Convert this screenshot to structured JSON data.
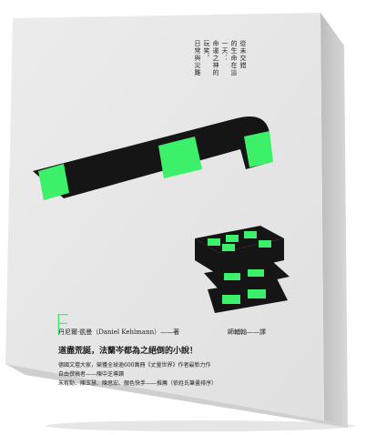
{
  "colors": {
    "cover": "#e9e9e9",
    "spine": "#c9c9c9",
    "ink": "#1a1a1a",
    "accent": "#3cf06a"
  },
  "cover": {
    "blurb_columns": [
      "從未交錯",
      "的生命在這",
      "一天：",
      "命運之神的",
      "玩笑，",
      "日常與災難"
    ],
    "letter_mark": "F",
    "author": "丹尼爾·凱曼（Daniel Kehlmann）——著",
    "translator": "師輔翰——譯",
    "tagline": "道盡荒誕，法蘭岑都為之絕倒的小說！",
    "description": [
      "德國文壇大家，榮獲全球逾600萬冊《丈量世界》作者最新力作",
      "自由撰稿者——陳中芝導讀",
      "朱宥勳、陳玉慧、陳思宏、顏色快手——推薦（依姓氏筆畫排序）"
    ]
  }
}
